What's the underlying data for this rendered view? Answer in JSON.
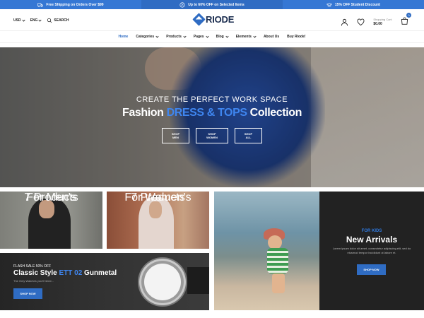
{
  "promo": {
    "items": [
      {
        "icon": "truck-icon",
        "label": "Free Shipping on Orders Over $99"
      },
      {
        "icon": "discount-badge-icon",
        "label": "Up to 60% OFF on Selected Items"
      },
      {
        "icon": "graduation-cap-icon",
        "label": "15% OFF Student Discount"
      }
    ]
  },
  "header": {
    "currency": "USD",
    "language": "ENG",
    "search_label": "SEARCH",
    "logo": "RIODE",
    "cart_label": "Shopping Cart:",
    "cart_total": "$0.00",
    "cart_count": "0"
  },
  "nav": {
    "items": [
      "Home",
      "Categories",
      "Products",
      "Pages",
      "Blog",
      "Elements",
      "About Us",
      "Buy Riode!"
    ]
  },
  "hero": {
    "subtitle": "CREATE THE PERFECT WORK SPACE",
    "title_pre": "Fashion ",
    "title_highlight": "DRESS & TOPS",
    "title_post": " Collection",
    "buttons": [
      "SHOP MEN",
      "SHOP WOMEN",
      "SHOP ALL"
    ]
  },
  "tiles": {
    "men": {
      "name": "For Men's",
      "count": "7 Products"
    },
    "women": {
      "name": "For Women's",
      "count": "7 Products"
    },
    "arrivals": {
      "kicker": "FOR KIDS",
      "title": "New Arrivals",
      "desc": "Lorem ipsum dolor sit amet, consectetur adipiscing elit, sed do eiusmod tempor incididunt ut labore et.",
      "button": "SHOP NOW"
    },
    "watch": {
      "kicker": "FLASH SALE 50% OFF",
      "title_pre": "Classic Style ",
      "title_highlight": "ETT 02",
      "title_post": " Gunmetal",
      "desc": "The Only Watches you'll Need...",
      "button": "SHOP NOW"
    }
  },
  "colors": {
    "accent": "#2f6cc3",
    "dark": "#222222"
  }
}
